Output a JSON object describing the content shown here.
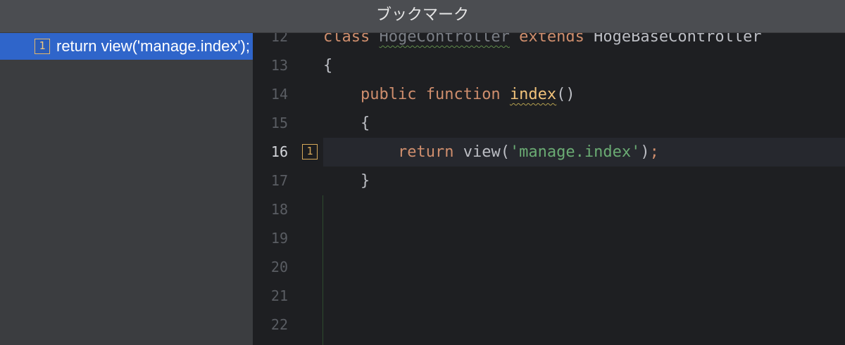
{
  "window": {
    "title": "ブックマーク"
  },
  "bookmarks": {
    "items": [
      {
        "mnemonic": "1",
        "label": "return view('manage.index');"
      }
    ]
  },
  "editor": {
    "current_line": "16",
    "gutter_bookmark": "1",
    "lines": [
      {
        "number": "12",
        "tokens": [
          "class",
          " ",
          "HogeController",
          " ",
          "extends",
          " ",
          "HogeBaseController"
        ]
      },
      {
        "number": "13",
        "tokens": [
          "{"
        ]
      },
      {
        "number": "14",
        "tokens": [
          "    ",
          "public",
          " ",
          "function",
          " ",
          "index",
          "()"
        ]
      },
      {
        "number": "15",
        "tokens": [
          "    ",
          "{"
        ]
      },
      {
        "number": "16",
        "tokens": [
          "        ",
          "return",
          " ",
          "view",
          "(",
          "'manage.index'",
          ")",
          ";"
        ]
      },
      {
        "number": "17",
        "tokens": [
          "    ",
          "}"
        ]
      },
      {
        "number": "18",
        "tokens": []
      },
      {
        "number": "19",
        "tokens": []
      },
      {
        "number": "20",
        "tokens": []
      },
      {
        "number": "21",
        "tokens": []
      },
      {
        "number": "22",
        "tokens": []
      }
    ]
  },
  "colors": {
    "selection": "#2f65ca",
    "keyword": "#cf8e6d",
    "string": "#6aab73",
    "function_declaration": "#f0c27a",
    "bookmark_badge": "#d6a85a"
  },
  "icons": {
    "bookmark": "bookmark-mnemonic-icon"
  }
}
